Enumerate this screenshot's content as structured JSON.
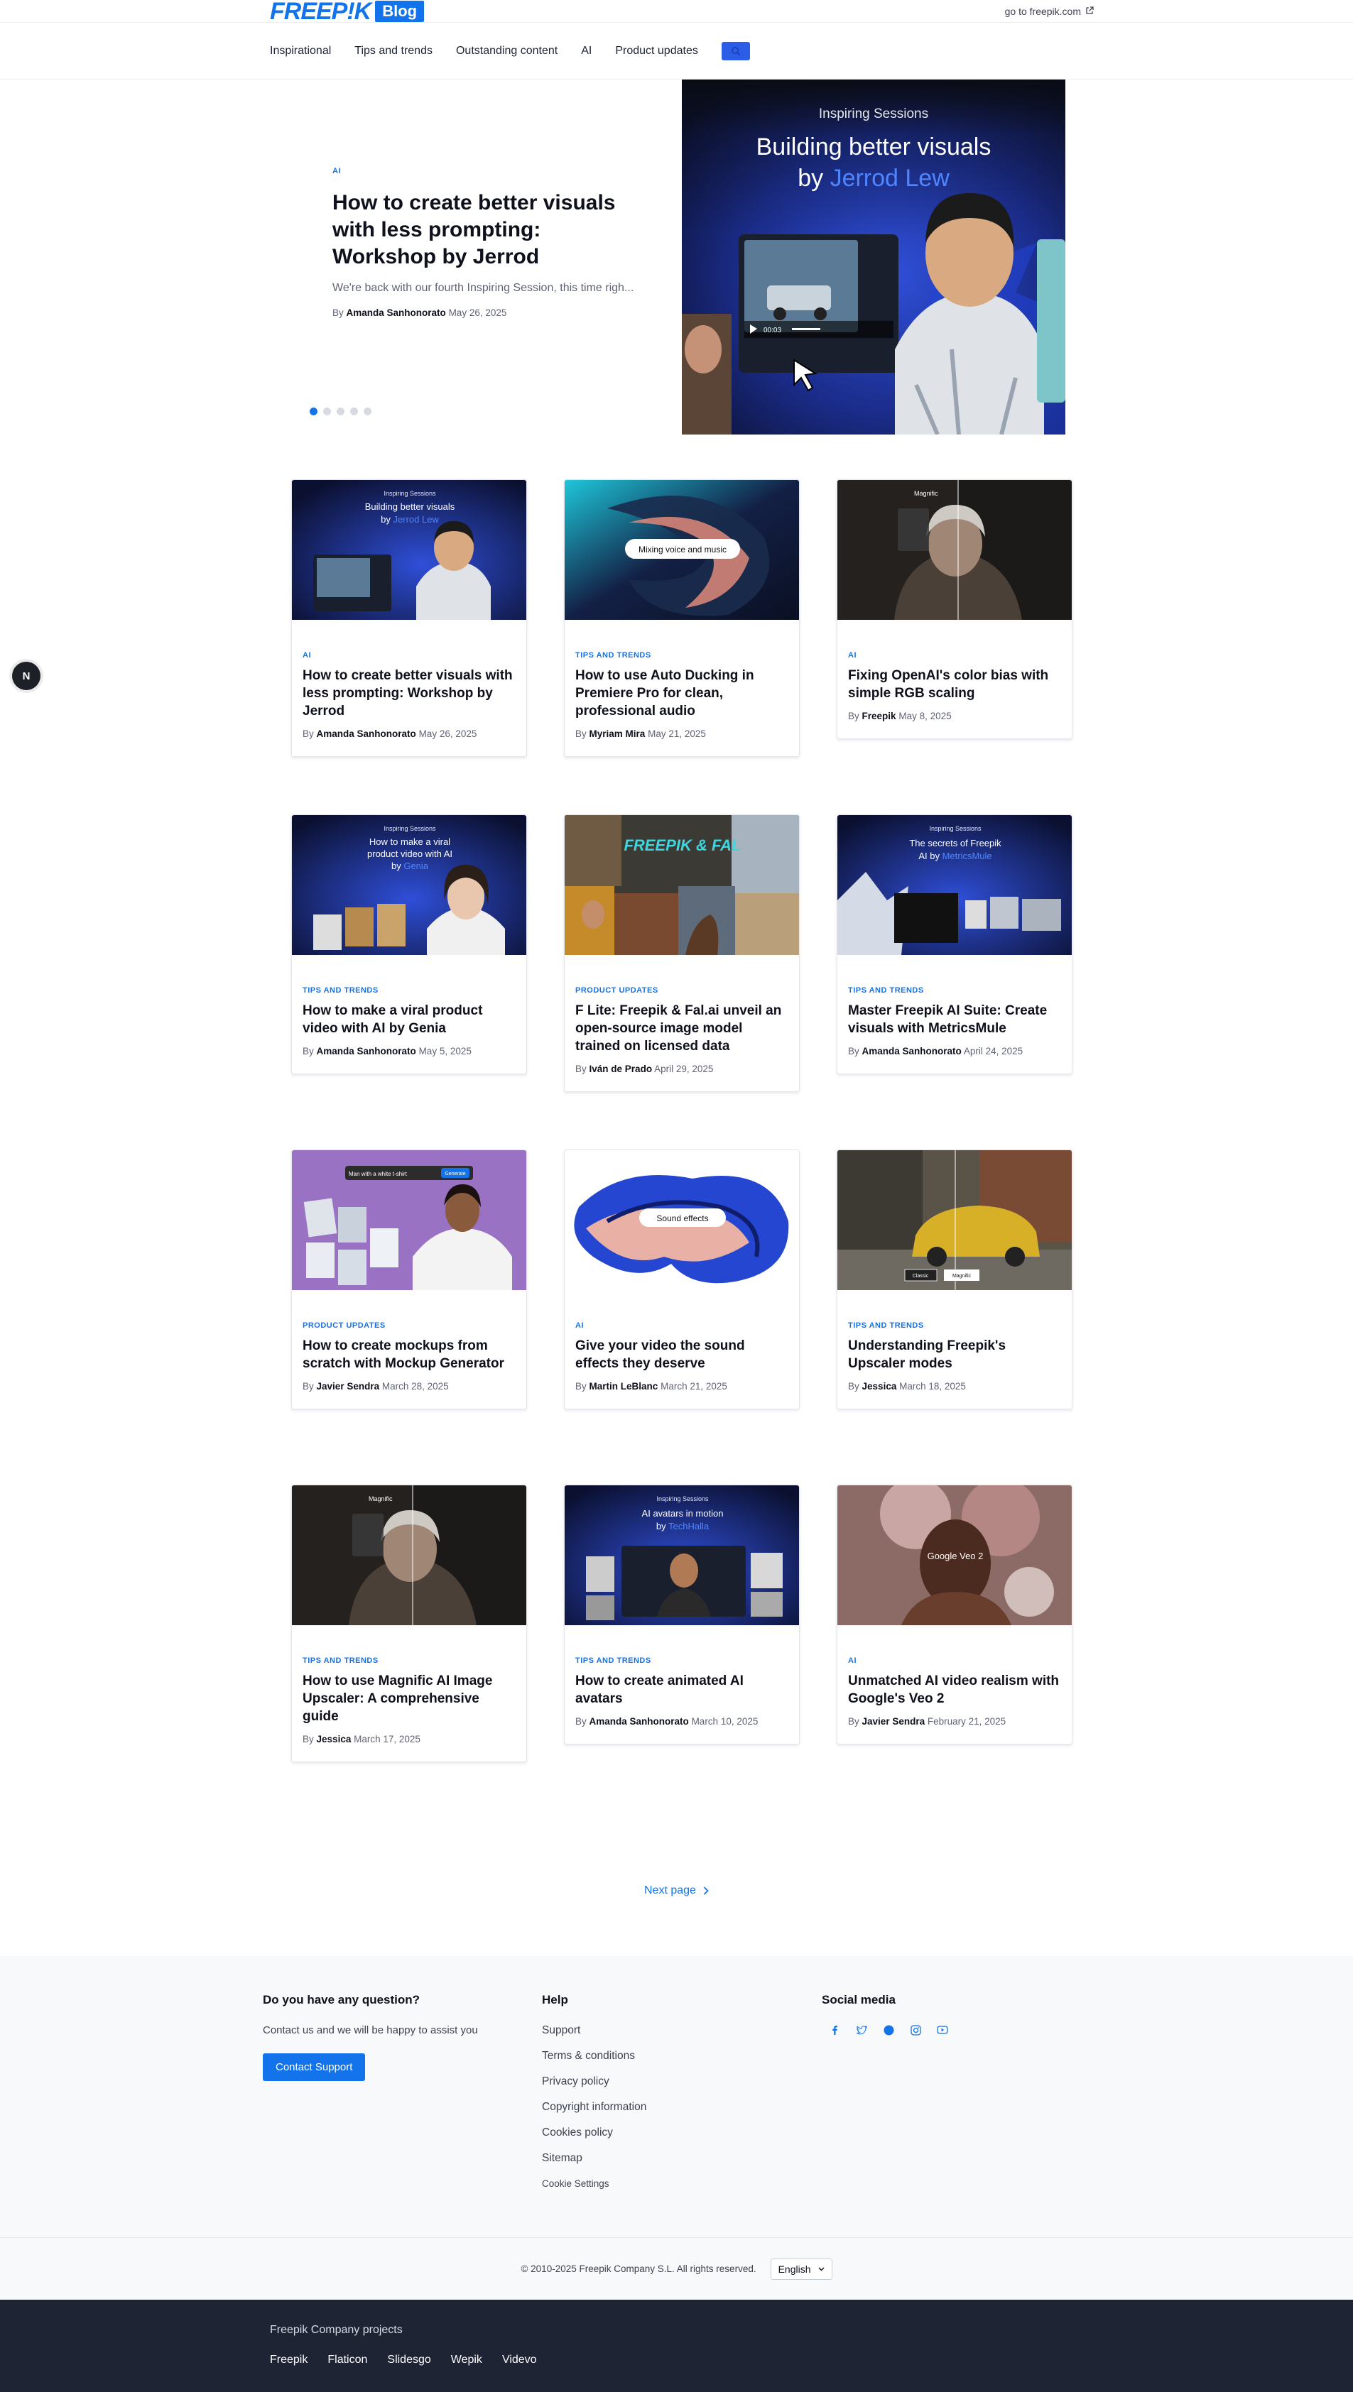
{
  "header": {
    "logo_text": "FREEP!K",
    "logo_badge": "Blog",
    "go_link": "go to freepik.com",
    "brand_color": "#1273eb"
  },
  "nav": {
    "items": [
      "Inspirational",
      "Tips and trends",
      "Outstanding content",
      "AI",
      "Product updates"
    ],
    "search_icon": "search-icon"
  },
  "hero": {
    "category": "AI",
    "title": "How to create better visuals with less prompting: Workshop by Jerrod",
    "excerpt": "We're back with our fourth Inspiring Session, this time righ...",
    "by": "By",
    "author": "Amanda Sanhonorato",
    "date": "May 26, 2025",
    "image": {
      "overline": "Inspiring Sessions",
      "headline": "Building better visuals",
      "by_prefix": "by",
      "by_name": "Jerrod Lew",
      "video_time": "00:03"
    },
    "slides": 5,
    "active_slide": 1
  },
  "articles": [
    {
      "category": "AI",
      "title": "How to create better visuals with less prompting: Workshop by Jerrod",
      "author": "Amanda Sanhonorato",
      "date": "May 26, 2025",
      "img_overline": "Inspiring Sessions",
      "img_line1": "Building better visuals",
      "img_line2": "by",
      "img_name": "Jerrod Lew"
    },
    {
      "category": "TIPS AND TRENDS",
      "title": "How to use Auto Ducking in Premiere Pro for clean, professional audio",
      "author": "Myriam Mira",
      "date": "May 21, 2025",
      "img_pill": "Mixing voice and music"
    },
    {
      "category": "AI",
      "title": "Fixing OpenAI's color bias with simple RGB scaling",
      "author": "Freepik",
      "date": "May 8, 2025",
      "img_logo": "Magnific"
    },
    {
      "category": "TIPS AND TRENDS",
      "title": "How to make a viral product video with AI by Genia",
      "author": "Amanda Sanhonorato",
      "date": "May 5, 2025",
      "img_overline": "Inspiring Sessions",
      "img_line1": "How to make a viral",
      "img_line2": "product video with AI",
      "img_line3": "by",
      "img_name": "Genia"
    },
    {
      "category": "PRODUCT UPDATES",
      "title": "F Lite: Freepik & Fal.ai unveil an open-source image model trained on licensed data",
      "author": "Iván de Prado",
      "date": "April 29, 2025",
      "img_logo": "FREEPIK & FAL"
    },
    {
      "category": "TIPS AND TRENDS",
      "title": "Master Freepik AI Suite: Create visuals with MetricsMule",
      "author": "Amanda Sanhonorato",
      "date": "April 24, 2025",
      "img_overline": "Inspiring Sessions",
      "img_line1": "The secrets of Freepik",
      "img_line2": "AI by",
      "img_name": "MetricsMule"
    },
    {
      "category": "PRODUCT UPDATES",
      "title": "How to create mockups from scratch with Mockup Generator",
      "author": "Javier Sendra",
      "date": "March 28, 2025",
      "img_pill": "Man with a white t-shirt",
      "img_button": "Generate"
    },
    {
      "category": "AI",
      "title": "Give your video the sound effects they deserve",
      "author": "Martin LeBlanc",
      "date": "March 21, 2025",
      "img_pill": "Sound effects"
    },
    {
      "category": "TIPS AND TRENDS",
      "title": "Understanding Freepik's Upscaler modes",
      "author": "Jessica",
      "date": "March 18, 2025",
      "img_tag1": "Classic",
      "img_tag2": "Magnific"
    },
    {
      "category": "TIPS AND TRENDS",
      "title": "How to use Magnific AI Image Upscaler: A comprehensive guide",
      "author": "Jessica",
      "date": "March 17, 2025",
      "img_logo": "Magnific"
    },
    {
      "category": "TIPS AND TRENDS",
      "title": "How to create animated AI avatars",
      "author": "Amanda Sanhonorato",
      "date": "March 10, 2025",
      "img_overline": "Inspiring Sessions",
      "img_line1": "AI avatars in motion",
      "img_line2": "by",
      "img_name": "TechHalla"
    },
    {
      "category": "AI",
      "title": "Unmatched AI video realism with Google's Veo 2",
      "author": "Javier Sendra",
      "date": "February 21, 2025",
      "img_logo": "Google Veo 2"
    }
  ],
  "byline_prefix": "By",
  "floating_badge": "N",
  "pagination": {
    "next_label": "Next page"
  },
  "footer": {
    "question_title": "Do you have any question?",
    "question_text": "Contact us and we will be happy to assist you",
    "contact_button": "Contact Support",
    "help_title": "Help",
    "help_links": [
      "Support",
      "Terms & conditions",
      "Privacy policy",
      "Copyright information",
      "Cookies policy",
      "Sitemap"
    ],
    "cookie_settings": "Cookie Settings",
    "social_title": "Social media",
    "social_icons": [
      "facebook-icon",
      "twitter-icon",
      "pinterest-icon",
      "instagram-icon",
      "youtube-icon"
    ],
    "copyright": "© 2010-2025 Freepik Company S.L. All rights reserved.",
    "language": "English"
  },
  "company": {
    "title": "Freepik Company projects",
    "links": [
      "Freepik",
      "Flaticon",
      "Slidesgo",
      "Wepik",
      "Videvo"
    ]
  }
}
